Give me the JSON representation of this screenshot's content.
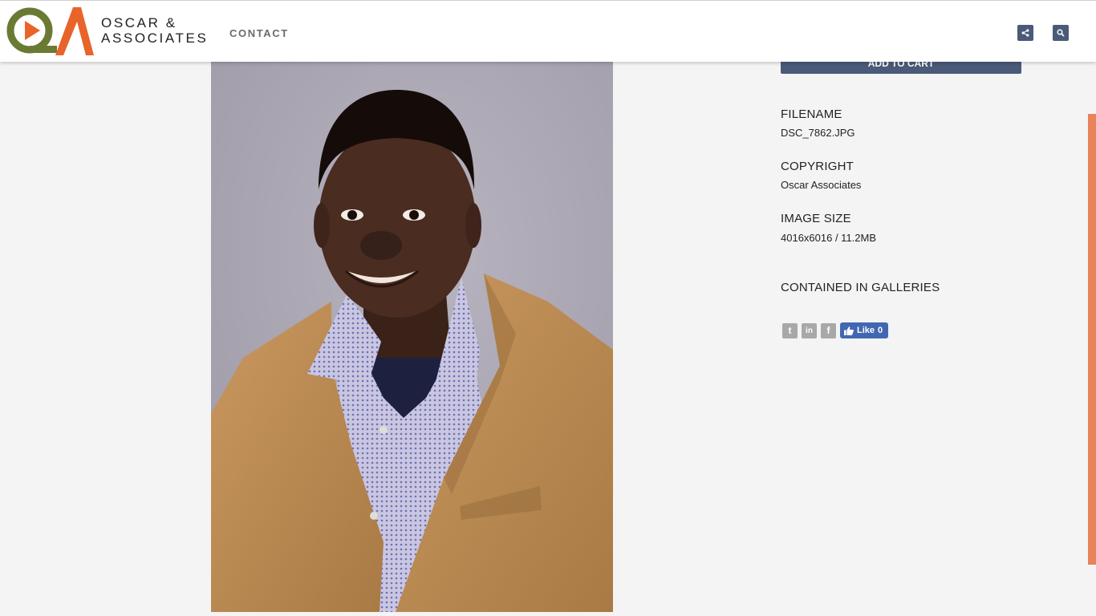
{
  "brand": {
    "line1": "OSCAR &",
    "line2": "ASSOCIATES",
    "logo_text": "QA",
    "colors": {
      "green": "#6b7a33",
      "orange": "#e8642a"
    }
  },
  "nav": {
    "contact_label": "CONTACT"
  },
  "header_buttons": {
    "share_icon": "share-icon",
    "search_icon": "search-icon"
  },
  "photo": {
    "subject": "portrait"
  },
  "cart": {
    "add_label": "ADD TO CART"
  },
  "details": {
    "filename_label": "FILENAME",
    "filename_value": "DSC_7862.JPG",
    "copyright_label": "COPYRIGHT",
    "copyright_value": "Oscar Associates",
    "size_label": "IMAGE SIZE",
    "size_value": "4016x6016 / 11.2MB",
    "galleries_label": "CONTAINED IN GALLERIES"
  },
  "social": {
    "twitter_glyph": "t",
    "linkedin_glyph": "in",
    "facebook_glyph": "f",
    "like_label": "Like",
    "like_count": "0"
  },
  "colors": {
    "accent": "#4a5a78",
    "scroll_thumb": "#e8835a",
    "background": "#f4f4f4"
  }
}
